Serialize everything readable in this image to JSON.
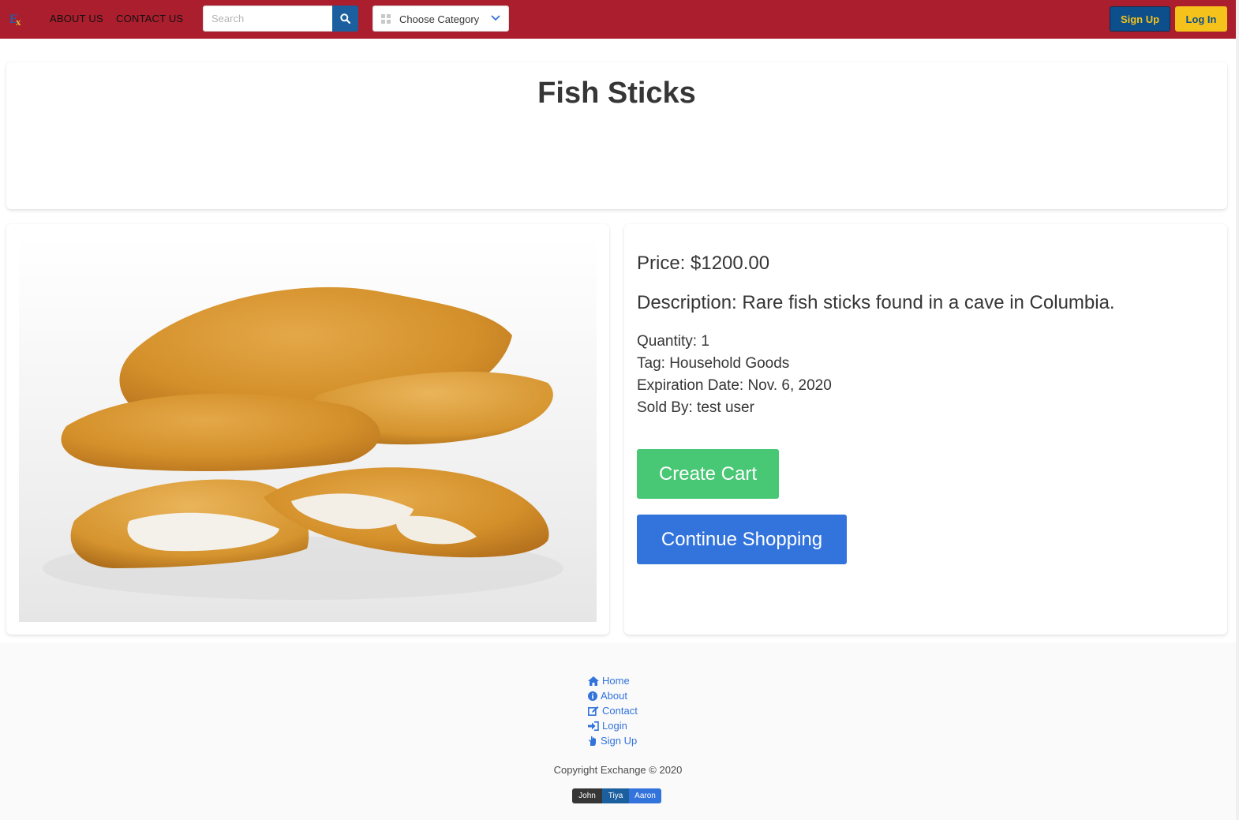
{
  "nav": {
    "about_label": "ABOUT US",
    "contact_label": "CONTACT US",
    "search_placeholder": "Search",
    "category_label": "Choose Category",
    "signup_label": "Sign Up",
    "login_label": "Log In"
  },
  "product": {
    "title": "Fish Sticks",
    "price": "Price: $1200.00",
    "description": "Description: Rare fish sticks found in a cave in Columbia.",
    "quantity": "Quantity: 1",
    "tag": "Tag: Household Goods",
    "expiration": "Expiration Date: Nov. 6, 2020",
    "sold_by": "Sold By: test user"
  },
  "actions": {
    "create_cart": "Create Cart",
    "continue_shopping": "Continue Shopping"
  },
  "footer": {
    "links": [
      {
        "label": "Home",
        "icon": "home-icon"
      },
      {
        "label": "About",
        "icon": "info-icon"
      },
      {
        "label": "Contact",
        "icon": "edit-icon"
      },
      {
        "label": "Login",
        "icon": "sign-in-icon"
      },
      {
        "label": "Sign Up",
        "icon": "hand-icon"
      }
    ],
    "copyright": "Copyright Exchange © 2020",
    "authors": [
      "John",
      "Tiya",
      "Aaron"
    ]
  },
  "colors": {
    "navbar": "#ab1e2d",
    "accent_blue": "#3273dc",
    "dark_blue": "#0d4f8b",
    "yellow": "#f5c21b",
    "success": "#48c774"
  }
}
